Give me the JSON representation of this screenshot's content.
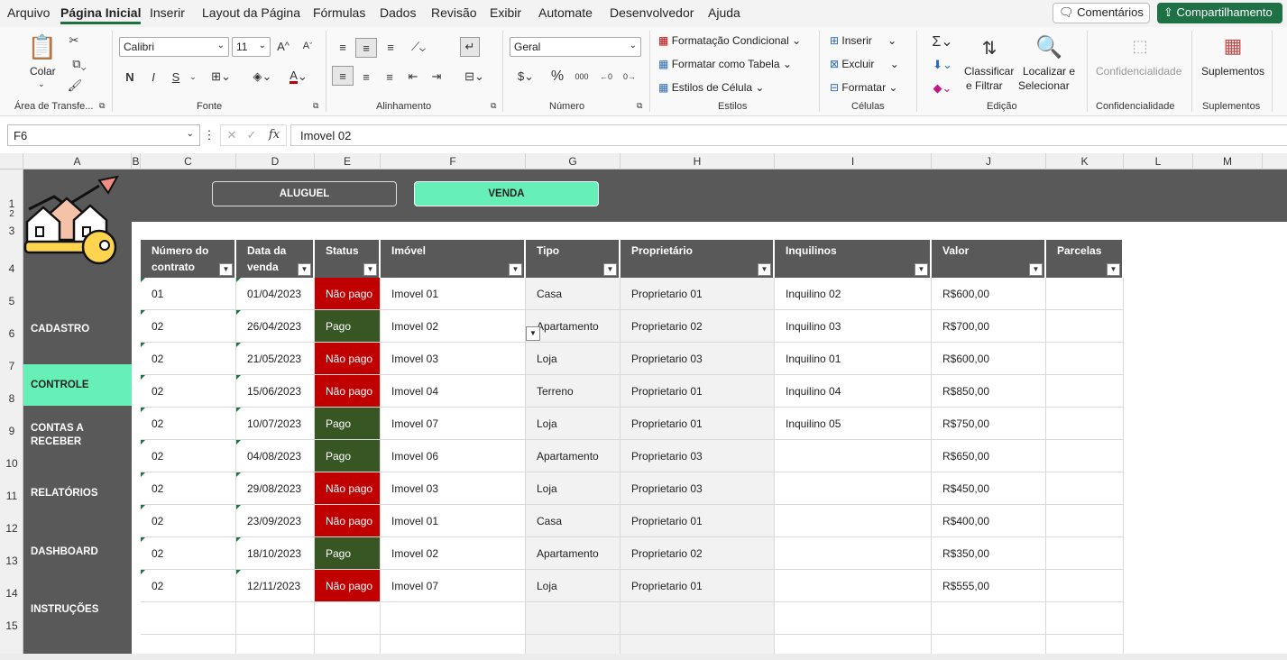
{
  "menu": {
    "items": [
      "Arquivo",
      "Página Inicial",
      "Inserir",
      "Layout da Página",
      "Fórmulas",
      "Dados",
      "Revisão",
      "Exibir",
      "Automate",
      "Desenvolvedor",
      "Ajuda"
    ],
    "comments_label": "Comentários",
    "share_label": "Compartilhamento"
  },
  "ribbon": {
    "clipboard": {
      "paste_label": "Colar",
      "group_label": "Área de Transfe..."
    },
    "font": {
      "name": "Calibri",
      "size": "11",
      "bold": "N",
      "italic": "I",
      "underline": "S",
      "group_label": "Fonte"
    },
    "alignment": {
      "group_label": "Alinhamento"
    },
    "number": {
      "format": "Geral",
      "group_label": "Número"
    },
    "styles": {
      "conditional": "Formatação Condicional",
      "as_table": "Formatar como Tabela",
      "cell_styles": "Estilos de Célula",
      "group_label": "Estilos"
    },
    "cells": {
      "insert": "Inserir",
      "delete": "Excluir",
      "format": "Formatar",
      "group_label": "Células"
    },
    "editing": {
      "sort_filter_1": "Classificar",
      "sort_filter_2": "e Filtrar",
      "find_1": "Localizar e",
      "find_2": "Selecionar",
      "group_label": "Edição"
    },
    "sensitivity": {
      "label": "Confidencialidade",
      "group_label": "Confidencialidade"
    },
    "addins": {
      "label": "Suplementos",
      "group_label": "Suplementos"
    }
  },
  "formula": {
    "namebox": "F6",
    "value": "Imovel 02"
  },
  "columns": [
    "A",
    "B",
    "C",
    "D",
    "E",
    "F",
    "G",
    "H",
    "I",
    "J",
    "K",
    "L",
    "M"
  ],
  "rows": [
    "1",
    "2",
    "3",
    "4",
    "5",
    "6",
    "7",
    "8",
    "9",
    "10",
    "11",
    "12",
    "13",
    "14",
    "15"
  ],
  "tabs": {
    "aluguel": "ALUGUEL",
    "venda": "VENDA"
  },
  "sidebar": [
    "CADASTRO",
    "CONTROLE",
    "CONTAS A RECEBER",
    "RELATÓRIOS",
    "DASHBOARD",
    "INSTRUÇÕES"
  ],
  "table": {
    "headers": [
      "Número do contrato",
      "Data da venda",
      "Status",
      "Imóvel",
      "Tipo",
      "Proprietário",
      "Inquilinos",
      "Valor",
      "Parcelas"
    ],
    "rows": [
      [
        "01",
        "01/04/2023",
        "Não pago",
        "Imovel 01",
        "Casa",
        "Proprietario 01",
        "Inquilino 02",
        "R$600,00",
        ""
      ],
      [
        "02",
        "26/04/2023",
        "Pago",
        "Imovel 02",
        "Apartamento",
        "Proprietario 02",
        "Inquilino 03",
        "R$700,00",
        ""
      ],
      [
        "02",
        "21/05/2023",
        "Não pago",
        "Imovel 03",
        "Loja",
        "Proprietario 03",
        "Inquilino 01",
        "R$600,00",
        ""
      ],
      [
        "02",
        "15/06/2023",
        "Não pago",
        "Imovel 04",
        "Terreno",
        "Proprietario 01",
        "Inquilino 04",
        "R$850,00",
        ""
      ],
      [
        "02",
        "10/07/2023",
        "Pago",
        "Imovel 07",
        "Loja",
        "Proprietario 01",
        "Inquilino 05",
        "R$750,00",
        ""
      ],
      [
        "02",
        "04/08/2023",
        "Pago",
        "Imovel 06",
        "Apartamento",
        "Proprietario 03",
        "",
        "R$650,00",
        ""
      ],
      [
        "02",
        "29/08/2023",
        "Não pago",
        "Imovel 03",
        "Loja",
        "Proprietario 03",
        "",
        "R$450,00",
        ""
      ],
      [
        "02",
        "23/09/2023",
        "Não pago",
        "Imovel 01",
        "Casa",
        "Proprietario 01",
        "",
        "R$400,00",
        ""
      ],
      [
        "02",
        "18/10/2023",
        "Pago",
        "Imovel 02",
        "Apartamento",
        "Proprietario 02",
        "",
        "R$350,00",
        ""
      ],
      [
        "02",
        "12/11/2023",
        "Não pago",
        "Imovel 07",
        "Loja",
        "Proprietario 01",
        "",
        "R$555,00",
        ""
      ]
    ]
  },
  "colors": {
    "accent": "#66f0b7",
    "dark": "#595959",
    "paid": "#375623",
    "unpaid": "#c00000",
    "excel_green": "#1e7145"
  }
}
